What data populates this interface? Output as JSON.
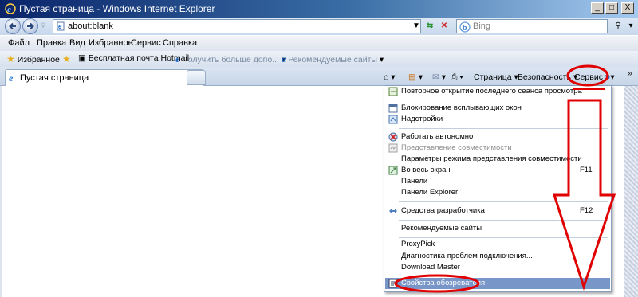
{
  "window": {
    "title": "Пустая страница - Windows Internet Explorer",
    "controls": {
      "minimize": "_",
      "maximize": "□",
      "close": "X"
    }
  },
  "address_bar": {
    "url": "about:blank",
    "search_placeholder": "Bing"
  },
  "menu_bar": {
    "items": [
      "Файл",
      "Правка",
      "Вид",
      "Избранное",
      "Сервис",
      "Справка"
    ]
  },
  "favorites_bar": {
    "favorites_label": "Избранное",
    "links": [
      {
        "label": "Бесплатная почта Hotmail",
        "disabled": false
      },
      {
        "label": "Получить больше допо...",
        "disabled": true
      },
      {
        "label": "Рекомендуемые сайты",
        "disabled": true
      }
    ]
  },
  "tab": {
    "label": "Пустая страница"
  },
  "command_bar": {
    "page": "Страница",
    "safety": "Безопасность",
    "tools": "Сервис",
    "overflow": "»"
  },
  "tools_menu": {
    "items": [
      {
        "label": "Повторное открытие последнего сеанса просмотра",
        "icon": "reopen-session-icon",
        "disabled": false,
        "shortcut": ""
      },
      {
        "label": "Блокирование всплывающих окон",
        "icon": "popup-blocker-icon",
        "disabled": false,
        "shortcut": ""
      },
      {
        "label": "Надстройки",
        "icon": "addons-icon",
        "disabled": false,
        "shortcut": ""
      },
      {
        "label": "Работать автономно",
        "icon": "offline-icon",
        "disabled": false,
        "shortcut": ""
      },
      {
        "label": "Представление совместимости",
        "icon": "compatibility-icon",
        "disabled": true,
        "shortcut": ""
      },
      {
        "label": "Параметры режима представления совместимости",
        "icon": "",
        "disabled": false,
        "shortcut": ""
      },
      {
        "label": "Во весь экран",
        "icon": "fullscreen-icon",
        "disabled": false,
        "shortcut": "F11"
      },
      {
        "label": "Панели",
        "icon": "",
        "disabled": false,
        "shortcut": ""
      },
      {
        "label": "Панели Explorer",
        "icon": "",
        "disabled": false,
        "shortcut": ""
      },
      {
        "label": "Средства разработчика",
        "icon": "developer-tools-icon",
        "disabled": false,
        "shortcut": "F12"
      },
      {
        "label": "Рекомендуемые сайты",
        "icon": "",
        "disabled": false,
        "shortcut": ""
      },
      {
        "label": "ProxyPick",
        "icon": "",
        "disabled": false,
        "shortcut": ""
      },
      {
        "label": "Диагностика проблем подключения...",
        "icon": "",
        "disabled": false,
        "shortcut": ""
      },
      {
        "label": "Download Master",
        "icon": "",
        "disabled": false,
        "shortcut": ""
      },
      {
        "label": "Свойства обозревателя",
        "icon": "internet-options-icon",
        "disabled": false,
        "shortcut": "",
        "highlighted": true
      }
    ]
  },
  "colors": {
    "title_bar": "#0a246a",
    "menu_highlight": "#7896c8",
    "annotation": "#e00000"
  }
}
